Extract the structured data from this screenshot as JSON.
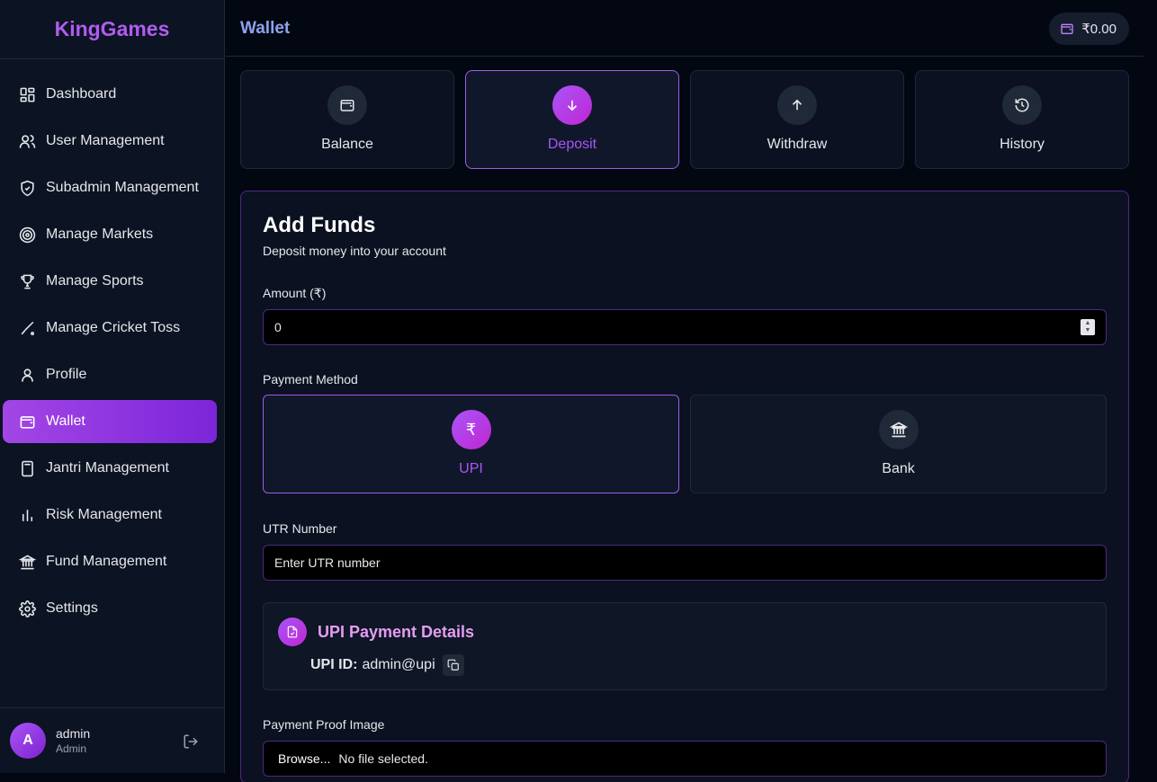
{
  "brand": "KingGames",
  "sidebar": {
    "items": [
      {
        "label": "Dashboard",
        "icon": "dashboard-icon"
      },
      {
        "label": "User Management",
        "icon": "users-icon"
      },
      {
        "label": "Subadmin Management",
        "icon": "shield-icon"
      },
      {
        "label": "Manage Markets",
        "icon": "target-icon"
      },
      {
        "label": "Manage Sports",
        "icon": "trophy-icon"
      },
      {
        "label": "Manage Cricket Toss",
        "icon": "cricket-bat-icon"
      },
      {
        "label": "Profile",
        "icon": "user-icon"
      },
      {
        "label": "Wallet",
        "icon": "wallet-icon",
        "active": true
      },
      {
        "label": "Jantri Management",
        "icon": "calculator-icon"
      },
      {
        "label": "Risk Management",
        "icon": "bar-chart-icon"
      },
      {
        "label": "Fund Management",
        "icon": "bank-icon"
      },
      {
        "label": "Settings",
        "icon": "gear-icon"
      }
    ]
  },
  "user": {
    "initial": "A",
    "name": "admin",
    "role": "Admin"
  },
  "header": {
    "title": "Wallet",
    "balance": "₹0.00"
  },
  "tabs": [
    {
      "label": "Balance",
      "icon": "wallet-icon"
    },
    {
      "label": "Deposit",
      "icon": "arrow-down-icon",
      "active": true
    },
    {
      "label": "Withdraw",
      "icon": "arrow-up-icon"
    },
    {
      "label": "History",
      "icon": "history-icon"
    }
  ],
  "form": {
    "title": "Add Funds",
    "subtitle": "Deposit money into your account",
    "amount_label": "Amount (₹)",
    "amount_value": "0",
    "payment_method_label": "Payment Method",
    "methods": [
      {
        "label": "UPI",
        "icon": "rupee-icon",
        "glyph": "₹",
        "active": true
      },
      {
        "label": "Bank",
        "icon": "bank-icon"
      }
    ],
    "utr_label": "UTR Number",
    "utr_placeholder": "Enter UTR number",
    "upi_details_title": "UPI Payment Details",
    "upi_id_label": "UPI ID:",
    "upi_id_value": "admin@upi",
    "proof_label": "Payment Proof Image",
    "browse_label": "Browse...",
    "file_status": "No file selected."
  },
  "colors": {
    "accent": "#a855f7",
    "background": "#030712",
    "sidebar": "#0c1322"
  }
}
